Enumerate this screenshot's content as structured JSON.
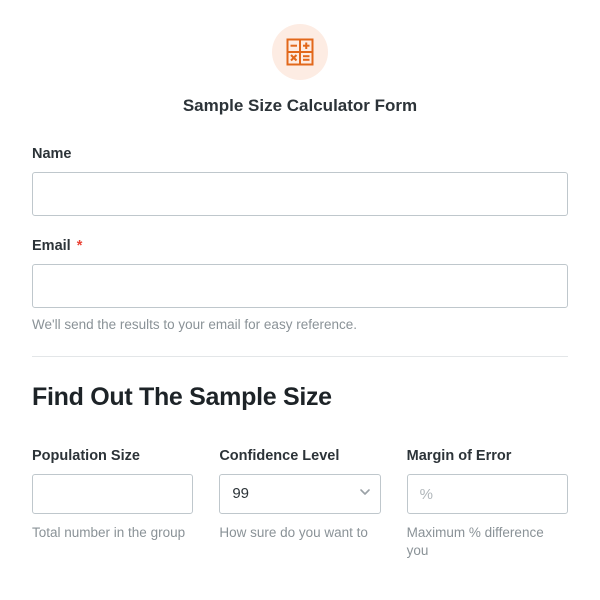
{
  "header": {
    "title": "Sample Size Calculator Form"
  },
  "fields": {
    "name": {
      "label": "Name",
      "value": ""
    },
    "email": {
      "label": "Email",
      "required_mark": "*",
      "value": "",
      "help": "We'll send the results to your email for easy reference."
    }
  },
  "section2": {
    "heading": "Find Out The Sample Size",
    "population": {
      "label": "Population Size",
      "value": "",
      "help": "Total number in the group"
    },
    "confidence": {
      "label": "Confidence Level",
      "selected": "99",
      "help": "How sure do you want to"
    },
    "margin": {
      "label": "Margin of Error",
      "placeholder": "%",
      "value": "",
      "help": "Maximum % difference you"
    }
  }
}
